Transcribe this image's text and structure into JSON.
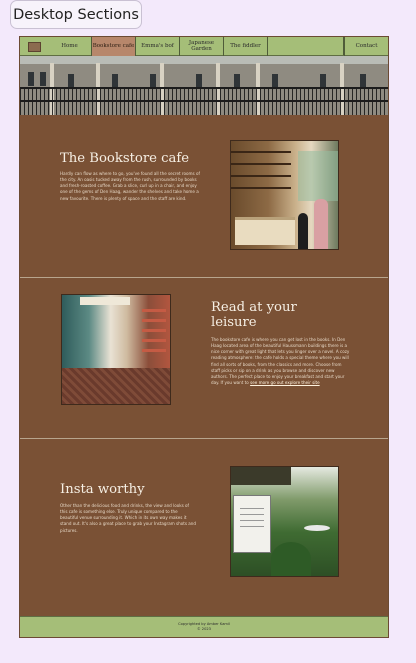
{
  "section_label": "Desktop Sections",
  "nav": {
    "items": [
      {
        "label": "Home",
        "active": false
      },
      {
        "label": "Bookstore cafe",
        "active": true
      },
      {
        "label": "Emma's bof",
        "active": false
      },
      {
        "label": "Japanese Garden",
        "active": false
      },
      {
        "label": "The fiddler",
        "active": false
      },
      {
        "label": "Contact",
        "active": false
      }
    ]
  },
  "sections": [
    {
      "title": "The Bookstore cafe",
      "body": "Hardly can flow as where to go, you've found all the secret rooms of the city. An oasis tucked away from the rush, surrounded by books and fresh-roasted coffee. Grab a slice, curl up in a chair, and enjoy one of the gems of Den Haag, wander the shelves and take home a new favourite. There is plenty of space and the staff are kind.",
      "image_alt": "bookstore cafe interior"
    },
    {
      "title": "Read at your leisure",
      "body": "The bookstore cafe is where you can get lost in the books. In Den Haag located area of the beautiful Haussmann buildings there is a nice corner with great light that lets you linger over a novel. A cozy reading atmosphere: the cafe holds a special theme where you will find all sorts of books, from the classics and more. Choose from staff picks or sip on a drink as you browse and discover new authors. The perfect place to enjoy your breakfast and start your day. If you want to",
      "link": "see more go out explore their site",
      "image_alt": "bookstore shelves"
    },
    {
      "title": "Insta worthy",
      "body": "Other than the delicious food and drinks, the view and looks of this cafe is something else. Truly unique compared to the beautiful venue surrounding it. Which in its own way makes it stand out. It's also a great place to grab your Instagram shots and pictures.",
      "image_alt": "garden terrace"
    }
  ],
  "footer": {
    "line1": "Copyrighted by Amber Kamil",
    "line2": "© 2023"
  },
  "colors": {
    "nav_bg": "#a5be78",
    "active_nav": "#b7876b",
    "section_bg": "#7a5135",
    "heading": "#f6efe4"
  }
}
